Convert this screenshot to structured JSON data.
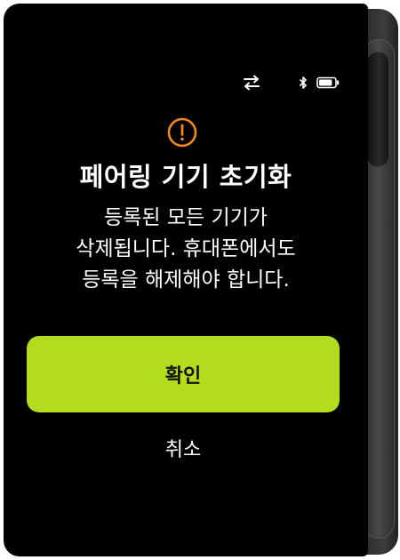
{
  "status_bar": {
    "sync_icon": "sync-arrows-icon",
    "bluetooth_icon": "bluetooth-icon",
    "battery_icon": "battery-icon",
    "battery_level": 0.85
  },
  "dialog": {
    "warning_icon": "exclamation-circle-icon",
    "warning_color": "#f08a1c",
    "title": "페어링 기기 초기화",
    "message_lines": [
      "등록된 모든 기기가",
      "삭제됩니다. 휴대폰에서도",
      "등록을 해제해야 합니다."
    ],
    "confirm_label": "확인",
    "confirm_color": "#b4dc1e",
    "cancel_label": "취소"
  }
}
